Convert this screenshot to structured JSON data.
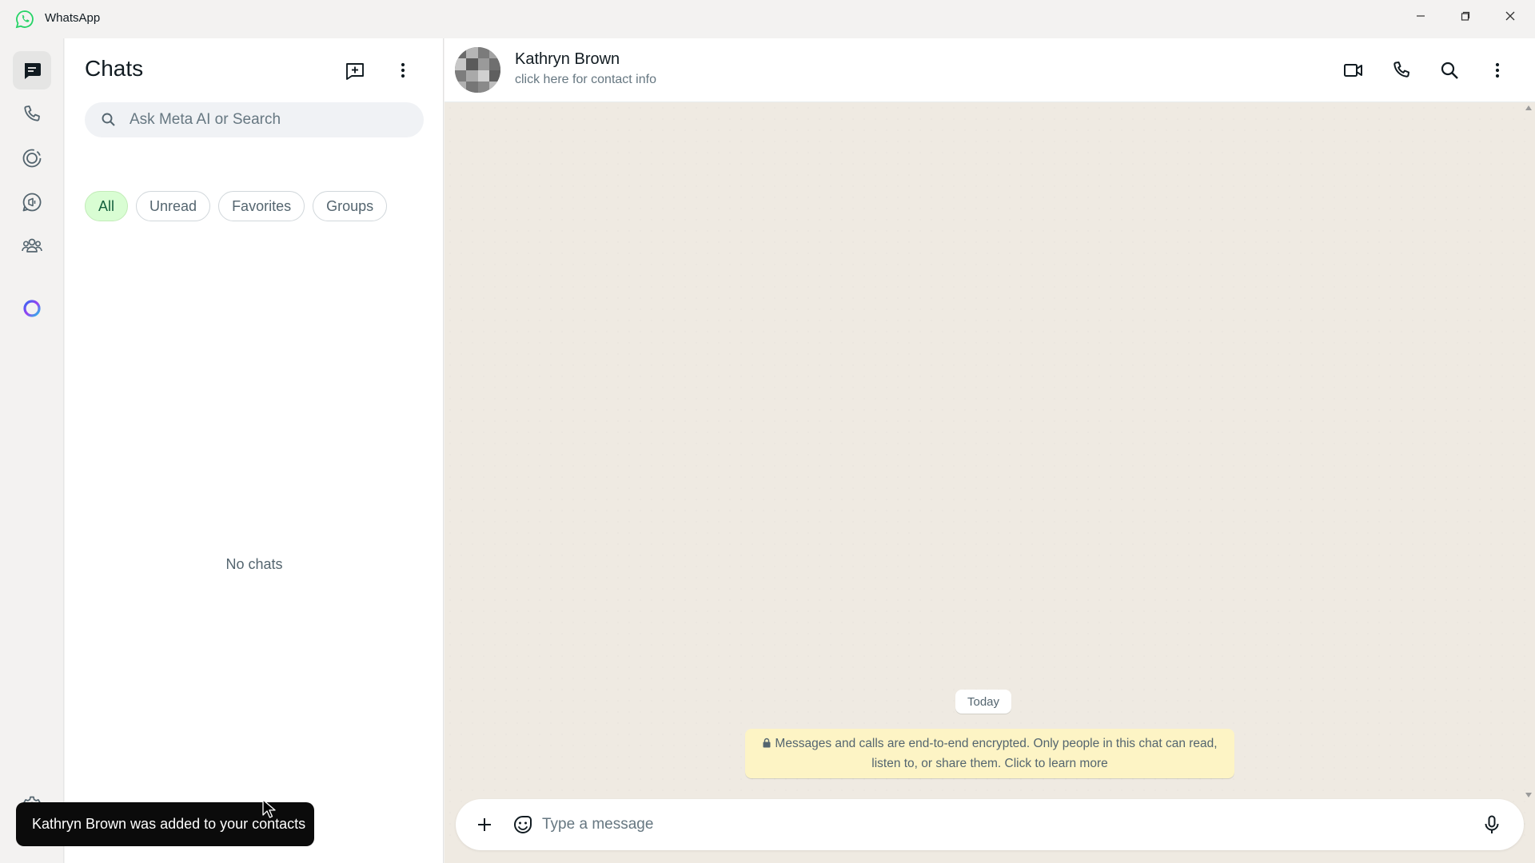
{
  "window": {
    "title": "WhatsApp"
  },
  "rail": {
    "items": [
      {
        "name": "chats",
        "icon": "chat-icon",
        "active": true
      },
      {
        "name": "calls",
        "icon": "phone-icon"
      },
      {
        "name": "status",
        "icon": "status-icon"
      },
      {
        "name": "channels",
        "icon": "channels-icon"
      },
      {
        "name": "communities",
        "icon": "communities-icon"
      },
      {
        "name": "meta-ai",
        "icon": "meta-ai-icon"
      }
    ],
    "settings_icon": "gear-icon"
  },
  "chatlist": {
    "title": "Chats",
    "search_placeholder": "Ask Meta AI or Search",
    "filters": [
      {
        "label": "All",
        "active": true
      },
      {
        "label": "Unread",
        "active": false
      },
      {
        "label": "Favorites",
        "active": false
      },
      {
        "label": "Groups",
        "active": false
      }
    ],
    "empty_text": "No chats"
  },
  "toast": {
    "text": "Kathryn Brown was added to your contacts"
  },
  "conversation": {
    "contact_name": "Kathryn Brown",
    "contact_subtitle": "click here for contact info",
    "date_label": "Today",
    "encryption_notice_line1": "Messages and calls are end-to-end encrypted. Only people in this chat can read,",
    "encryption_notice_line2": "listen to, or share them. Click to learn more",
    "composer_placeholder": "Type a message"
  },
  "colors": {
    "accent_green": "#25d366",
    "chip_active_bg": "#d9fdd3",
    "notice_bg": "#fdf4c5",
    "wallpaper": "#efeae2"
  }
}
